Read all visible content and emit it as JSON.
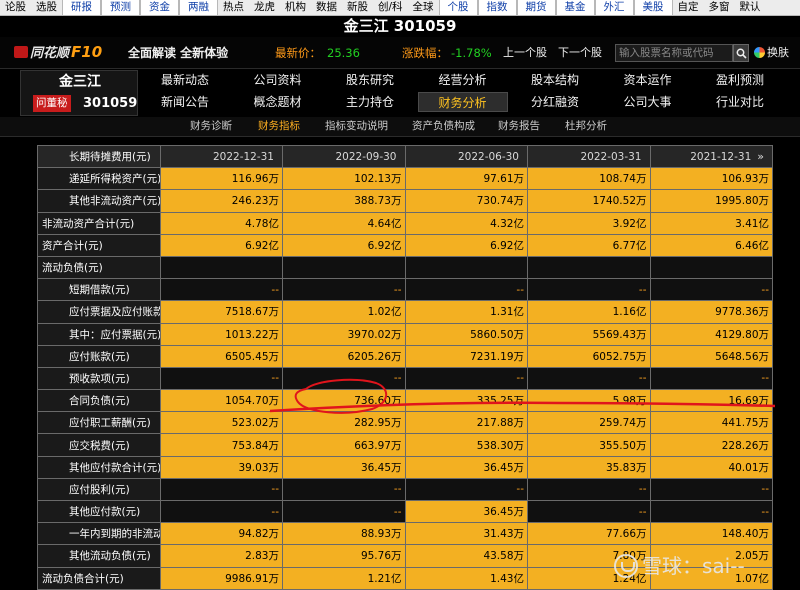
{
  "menubar": {
    "items": [
      "论股",
      "选股",
      "研报",
      "预测",
      "资金",
      "两融",
      "热点",
      "龙虎",
      "机构",
      "数据",
      "新股",
      "创/科",
      "全球",
      "个股",
      "指数",
      "期货",
      "基金",
      "外汇",
      "美股",
      "自定",
      "多窗",
      "默认"
    ]
  },
  "title": "金三江 301059",
  "header": {
    "logo_text": "同花顺",
    "logo_f10": "F10",
    "slogan": "全面解读 全新体验",
    "price_label": "最新价：",
    "price_value": "25.36",
    "change_label": "涨跌幅：",
    "change_value": "-1.78%",
    "prev_stock": "上一个股",
    "next_stock": "下一个股",
    "search_placeholder": "输入股票名称或代码",
    "skin_label": "换肤"
  },
  "stock": {
    "name": "金三江",
    "badge": "问董秘",
    "code": "301059"
  },
  "nav": {
    "row1": [
      "最新动态",
      "公司资料",
      "股东研究",
      "经营分析",
      "股本结构",
      "资本运作",
      "盈利预测"
    ],
    "row2": [
      "新闻公告",
      "概念题材",
      "主力持仓",
      "财务分析",
      "分红融资",
      "公司大事",
      "行业对比"
    ],
    "active": "财务分析"
  },
  "subnav": {
    "items": [
      "财务诊断",
      "财务指标",
      "指标变动说明",
      "资产负债构成",
      "财务报告",
      "杜邦分析"
    ],
    "active": "财务指标"
  },
  "table": {
    "header_label": "长期待摊费用(元)",
    "dates": [
      "2022-12-31",
      "2022-09-30",
      "2022-06-30",
      "2022-03-31",
      "2021-12-31"
    ],
    "more_icon": "double-chevron-right-icon",
    "rows": [
      {
        "label": "递延所得税资产(元)",
        "indent": true,
        "values": [
          "116.96万",
          "102.13万",
          "97.61万",
          "108.74万",
          "106.93万"
        ]
      },
      {
        "label": "其他非流动资产(元)",
        "indent": true,
        "values": [
          "246.23万",
          "388.73万",
          "730.74万",
          "1740.52万",
          "1995.80万"
        ]
      },
      {
        "label": "非流动资产合计(元)",
        "indent": false,
        "values": [
          "4.78亿",
          "4.64亿",
          "4.32亿",
          "3.92亿",
          "3.41亿"
        ]
      },
      {
        "label": "资产合计(元)",
        "indent": false,
        "values": [
          "6.92亿",
          "6.92亿",
          "6.92亿",
          "6.77亿",
          "6.46亿"
        ]
      },
      {
        "label": "流动负债(元)",
        "indent": false,
        "values": [
          "",
          "",
          "",
          "",
          ""
        ]
      },
      {
        "label": "短期借款(元)",
        "indent": true,
        "values": [
          "--",
          "--",
          "--",
          "--",
          "--"
        ]
      },
      {
        "label": "应付票据及应付账款(元)",
        "indent": true,
        "values": [
          "7518.67万",
          "1.02亿",
          "1.31亿",
          "1.16亿",
          "9778.36万"
        ]
      },
      {
        "label": "其中：应付票据(元)",
        "indent": true,
        "values": [
          "1013.22万",
          "3970.02万",
          "5860.50万",
          "5569.43万",
          "4129.80万"
        ]
      },
      {
        "label": "应付账款(元)",
        "indent": true,
        "values": [
          "6505.45万",
          "6205.26万",
          "7231.19万",
          "6052.75万",
          "5648.56万"
        ]
      },
      {
        "label": "预收款项(元)",
        "indent": true,
        "values": [
          "--",
          "--",
          "--",
          "--",
          "--"
        ]
      },
      {
        "label": "合同负债(元)",
        "indent": true,
        "values": [
          "1054.70万",
          "736.60万",
          "335.25万",
          "5.98万",
          "16.69万"
        ]
      },
      {
        "label": "应付职工薪酬(元)",
        "indent": true,
        "values": [
          "523.02万",
          "282.95万",
          "217.88万",
          "259.74万",
          "441.75万"
        ]
      },
      {
        "label": "应交税费(元)",
        "indent": true,
        "values": [
          "753.84万",
          "663.97万",
          "538.30万",
          "355.50万",
          "228.26万"
        ]
      },
      {
        "label": "其他应付款合计(元)",
        "indent": true,
        "values": [
          "39.03万",
          "36.45万",
          "36.45万",
          "35.83万",
          "40.01万"
        ]
      },
      {
        "label": "应付股利(元)",
        "indent": true,
        "values": [
          "--",
          "--",
          "--",
          "--",
          "--"
        ]
      },
      {
        "label": "其他应付款(元)",
        "indent": true,
        "values": [
          "--",
          "--",
          "36.45万",
          "--",
          "--"
        ]
      },
      {
        "label": "一年内到期的非流动负债(元)",
        "indent": true,
        "values": [
          "94.82万",
          "88.93万",
          "31.43万",
          "77.66万",
          "148.40万"
        ]
      },
      {
        "label": "其他流动负债(元)",
        "indent": true,
        "values": [
          "2.83万",
          "95.76万",
          "43.58万",
          "7.80万",
          "2.05万"
        ]
      },
      {
        "label": "流动负债合计(元)",
        "indent": false,
        "values": [
          "9986.91万",
          "1.21亿",
          "1.43亿",
          "1.24亿",
          "1.07亿"
        ]
      }
    ]
  },
  "watermark": "雪球：sai--",
  "colors": {
    "value_cell_bg": "#f3b022",
    "accent_orange": "#ff9a18",
    "down_green": "#22d022",
    "annotation_red": "#e0141c"
  }
}
